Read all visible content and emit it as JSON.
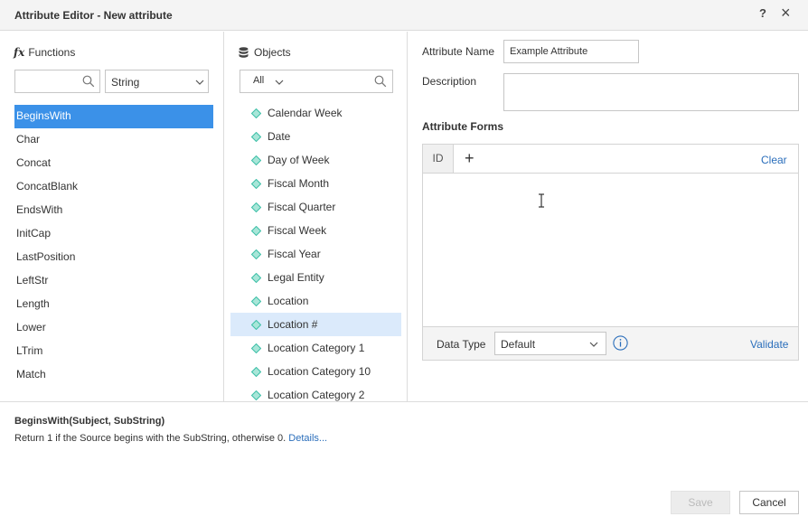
{
  "window": {
    "title": "Attribute Editor - New attribute",
    "help_label": "?",
    "close_label": "×"
  },
  "functions": {
    "heading": "Functions",
    "search": {
      "value": "",
      "placeholder": ""
    },
    "category": "String",
    "items": [
      "BeginsWith",
      "Char",
      "Concat",
      "ConcatBlank",
      "EndsWith",
      "InitCap",
      "LastPosition",
      "LeftStr",
      "Length",
      "Lower",
      "LTrim",
      "Match"
    ],
    "selected": "BeginsWith"
  },
  "objects": {
    "heading": "Objects",
    "filter": "All",
    "items": [
      "Calendar Week",
      "Date",
      "Day of Week",
      "Fiscal Month",
      "Fiscal Quarter",
      "Fiscal Week",
      "Fiscal Year",
      "Legal Entity",
      "Location",
      "Location #",
      "Location Category 1",
      "Location Category 10",
      "Location Category 2"
    ],
    "selected": "Location #"
  },
  "attribute": {
    "name_label": "Attribute Name",
    "name_value": "Example Attribute",
    "description_label": "Description",
    "description_value": "",
    "forms_heading": "Attribute Forms",
    "forms_tab": "ID",
    "add_label": "+",
    "clear_label": "Clear",
    "data_type_label": "Data Type",
    "data_type_value": "Default",
    "validate_label": "Validate"
  },
  "help_panel": {
    "signature": "BeginsWith(Subject, SubString)",
    "description": "Return 1 if the Source begins with the SubString, otherwise 0.",
    "details_link": "Details..."
  },
  "buttons": {
    "save": "Save",
    "cancel": "Cancel"
  },
  "colors": {
    "selection": "#3b91e8",
    "object_selection": "#dbeafb",
    "link": "#2a6ebb",
    "attribute_icon": "#3dbfa7"
  },
  "icons": {
    "functions": "fx-icon",
    "objects": "database-icon",
    "object_item": "attribute-diamond-icon",
    "search": "search-icon",
    "info": "info-icon"
  }
}
